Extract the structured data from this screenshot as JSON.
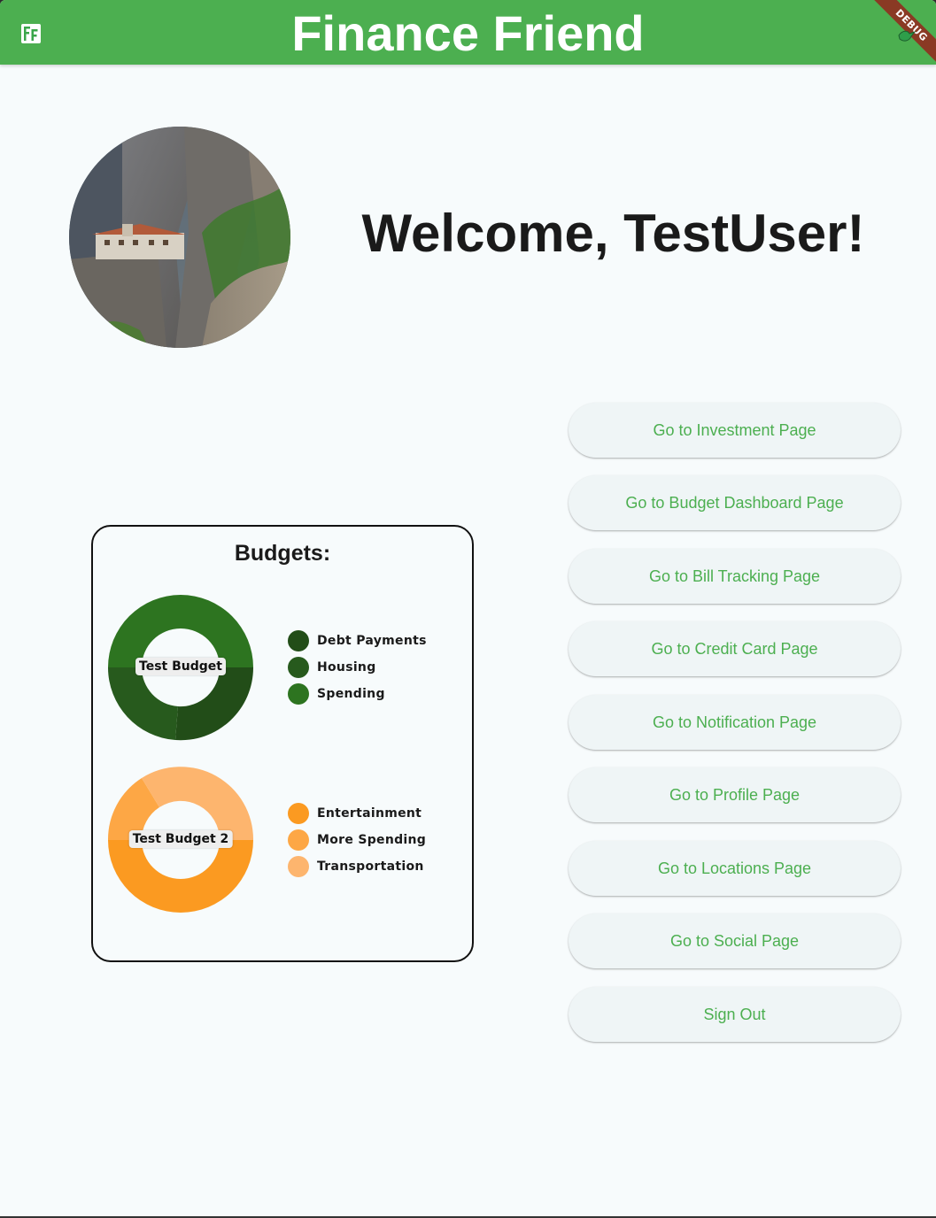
{
  "appbar": {
    "title": "Finance Friend",
    "logo_icon": "ff-logo-icon",
    "color": "#4caf50",
    "debug_badge": "DEBUG"
  },
  "welcome": {
    "text": "Welcome, TestUser!"
  },
  "budgets": {
    "title": "Budgets:",
    "charts": [
      {
        "center_label": "Test Budget",
        "legend": [
          {
            "label": "Debt Payments",
            "color": "#224d18"
          },
          {
            "label": "Housing",
            "color": "#275a1d"
          },
          {
            "label": "Spending",
            "color": "#2d7420"
          }
        ]
      },
      {
        "center_label": "Test Budget 2",
        "legend": [
          {
            "label": "Entertainment",
            "color": "#fb9a21"
          },
          {
            "label": "More Spending",
            "color": "#fda745"
          },
          {
            "label": "Transportation",
            "color": "#fdb56e"
          }
        ]
      }
    ]
  },
  "nav": {
    "buttons": [
      "Go to Investment Page",
      "Go to Budget Dashboard Page",
      "Go to Bill Tracking Page",
      "Go to Credit Card Page",
      "Go to Notification Page",
      "Go to Profile Page",
      "Go to Locations Page",
      "Go to Social Page",
      "Sign Out"
    ],
    "text_color": "#4caf50"
  }
}
